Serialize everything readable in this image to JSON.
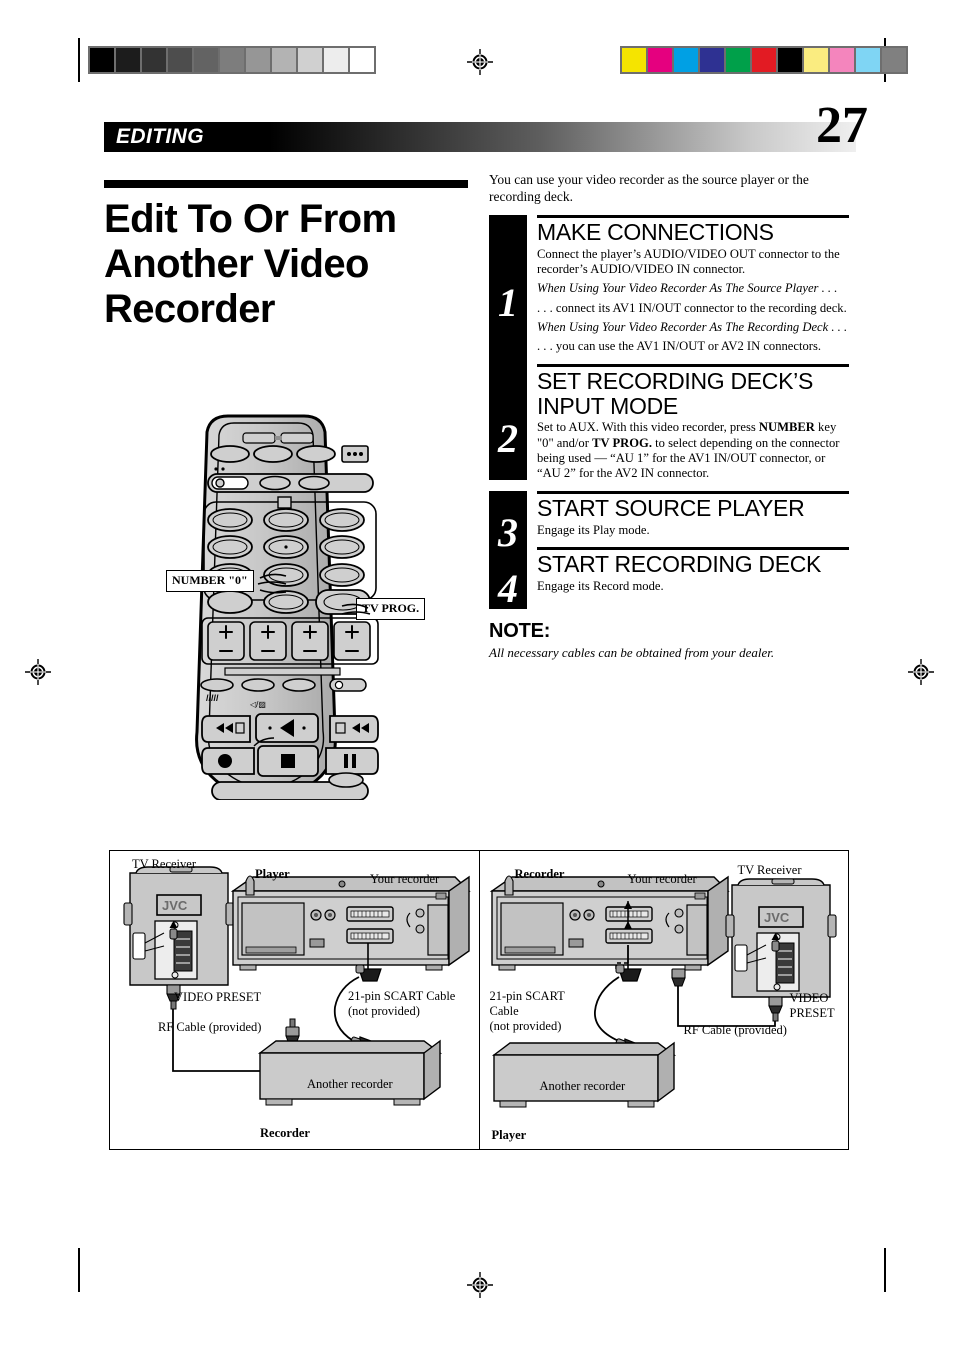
{
  "print_marks": {
    "grayscale_bar": [
      "#000000",
      "#1c1c1c",
      "#333333",
      "#4d4d4d",
      "#636363",
      "#7d7d7d",
      "#969696",
      "#b3b3b3",
      "#d0d0d0",
      "#ededed",
      "#ffffff"
    ],
    "color_bar": [
      "#f5e400",
      "#e5007f",
      "#00a0e4",
      "#2e3192",
      "#00a04a",
      "#e21b23",
      "#000000",
      "#faec80",
      "#f485bd",
      "#7fd5f4",
      "#808080"
    ],
    "registration_icon": "registration-target-icon"
  },
  "header": {
    "section_label": "EDITING",
    "page_number": "27"
  },
  "title": "Edit To Or From Another Video Recorder",
  "intro": "You can use your video recorder as the source player or the recording deck.",
  "steps": [
    {
      "number": "1",
      "heading": "MAKE CONNECTIONS",
      "paragraphs": [
        {
          "style": "normal",
          "text": "Connect the player’s AUDIO/VIDEO OUT connector to the recorder’s AUDIO/VIDEO IN connector."
        },
        {
          "style": "italic",
          "text": "When Using Your Video Recorder As The Source Player . . ."
        },
        {
          "style": "normal",
          "text": ". . . connect its AV1 IN/OUT connector to the recording deck."
        },
        {
          "style": "italic",
          "text": "When Using Your Video Recorder As The Recording Deck . . ."
        },
        {
          "style": "normal",
          "text": " . . . you can use the AV1 IN/OUT or AV2 IN connectors."
        }
      ]
    },
    {
      "number": "2",
      "heading": "SET RECORDING DECK’S INPUT MODE",
      "paragraphs": [
        {
          "style": "rich",
          "text": "Set to AUX. With this video recorder, press NUMBER key \"0\" and/or TV PROG. to select depending on the connector being used — “AU 1” for the AV1 IN/OUT connector, or “AU 2” for the AV2 IN connector."
        }
      ]
    },
    {
      "number": "3",
      "heading": "START SOURCE PLAYER",
      "paragraphs": [
        {
          "style": "normal",
          "text": "Engage its Play mode."
        }
      ]
    },
    {
      "number": "4",
      "heading": "START RECORDING DECK",
      "paragraphs": [
        {
          "style": "normal",
          "text": "Engage its Record mode."
        }
      ]
    }
  ],
  "note": {
    "title": "NOTE:",
    "text": "All necessary cables can be obtained from your dealer."
  },
  "remote_callouts": {
    "number_key": "NUMBER \"0\"",
    "tv_prog": "TV PROG."
  },
  "diagram": {
    "left_panel": {
      "tv_receiver": "TV Receiver",
      "tv_brand": "JVC",
      "role_top": "Player",
      "your_recorder": "Your recorder",
      "video_preset": "VIDEO PRESET",
      "rf_cable": "RF Cable (provided)",
      "scart_cable_line1": "21-pin SCART Cable",
      "scart_cable_line2": "(not provided)",
      "another_recorder": "Another recorder",
      "role_bottom": "Recorder"
    },
    "right_panel": {
      "tv_receiver": "TV Receiver",
      "tv_brand": "JVC",
      "role_top": "Recorder",
      "your_recorder": "Your recorder",
      "video_preset_line1": "VIDEO",
      "video_preset_line2": "PRESET",
      "rf_cable": "RF Cable (provided)",
      "scart_cable_line1": "21-pin SCART",
      "scart_cable_line2": "Cable",
      "scart_cable_line3": "(not provided)",
      "another_recorder": "Another recorder",
      "role_bottom": "Player"
    }
  }
}
